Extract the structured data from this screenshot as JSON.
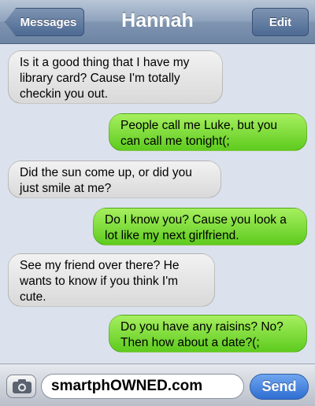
{
  "navbar": {
    "back_label": "Messages",
    "title": "Hannah",
    "edit_label": "Edit"
  },
  "messages": [
    {
      "direction": "incoming",
      "text": "Is it a good thing that I have my library card? Cause I'm totally checkin you out."
    },
    {
      "direction": "outgoing",
      "text": "People call me Luke, but you can call me tonight(;"
    },
    {
      "direction": "incoming",
      "text": "Did the sun come up, or did you just smile at me?"
    },
    {
      "direction": "outgoing",
      "text": "Do I know you? Cause you look a lot like my next girlfriend."
    },
    {
      "direction": "incoming",
      "text": "See my friend over there? He wants to know if you think I'm cute."
    },
    {
      "direction": "outgoing",
      "text": "Do you have any raisins? No? Then how about a date?(;"
    }
  ],
  "composer": {
    "camera_icon": "camera-icon",
    "input_value": "smartphOWNED.com",
    "send_label": "Send"
  },
  "colors": {
    "incoming_bubble": "#e3e3e3",
    "outgoing_bubble": "#7ddd3a",
    "background": "#dbe2ed",
    "send_button": "#3f7ddb"
  }
}
